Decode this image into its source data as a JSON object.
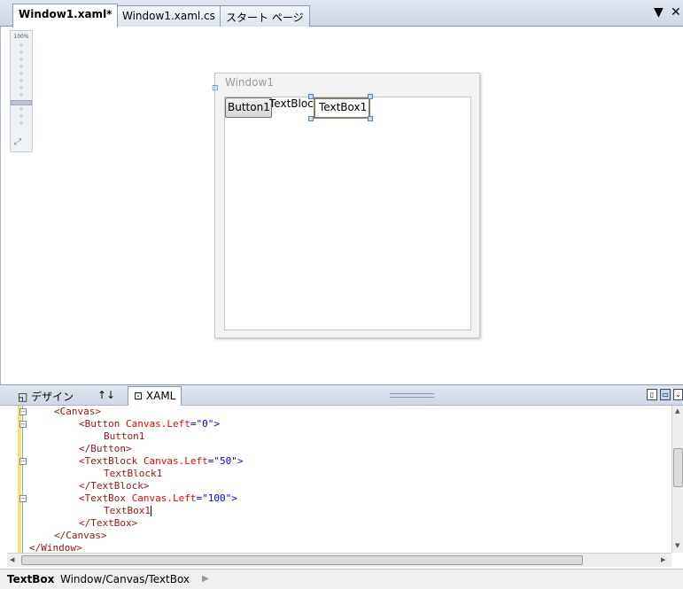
{
  "tabs": [
    {
      "label": "Window1.xaml*",
      "active": true
    },
    {
      "label": "Window1.xaml.cs",
      "active": false
    },
    {
      "label": "スタート ページ",
      "active": false
    }
  ],
  "zoom": {
    "label": "100%",
    "level": 1.0
  },
  "designer": {
    "window_title": "Window1",
    "button_text": "Button1",
    "textblock_text": "TextBlock1",
    "textbox_text": "TextBox1"
  },
  "view_tabs": {
    "design_label": "デザイン",
    "swap_label": "↑↓",
    "xaml_label": "XAML"
  },
  "code_lines": {
    "l1": "<Canvas>",
    "l2_tag": "<Button",
    "l2_attr": " Canvas.Left",
    "l2_eq": "=",
    "l2_val": "\"0\"",
    "l2_end": ">",
    "l3": "Button1",
    "l4": "</Button>",
    "l5_tag": "<TextBlock",
    "l5_attr": " Canvas.Left",
    "l5_eq": "=",
    "l5_val": "\"50\"",
    "l5_end": ">",
    "l6": "TextBlock1",
    "l7": "</TextBlock>",
    "l8_tag": "<TextBox",
    "l8_attr": " Canvas.Left",
    "l8_eq": "=",
    "l8_val": "\"100\"",
    "l8_end": ">",
    "l9": "TextBox1",
    "l10": "</TextBox>",
    "l11": "</Canvas>",
    "l12": "</Window>"
  },
  "status": {
    "element": "TextBox",
    "path": "Window/Canvas/TextBox"
  },
  "colors": {
    "tag": "#a31515",
    "attribute": "#ff0000",
    "value": "#0000ff",
    "outline": "#f2e27a"
  }
}
